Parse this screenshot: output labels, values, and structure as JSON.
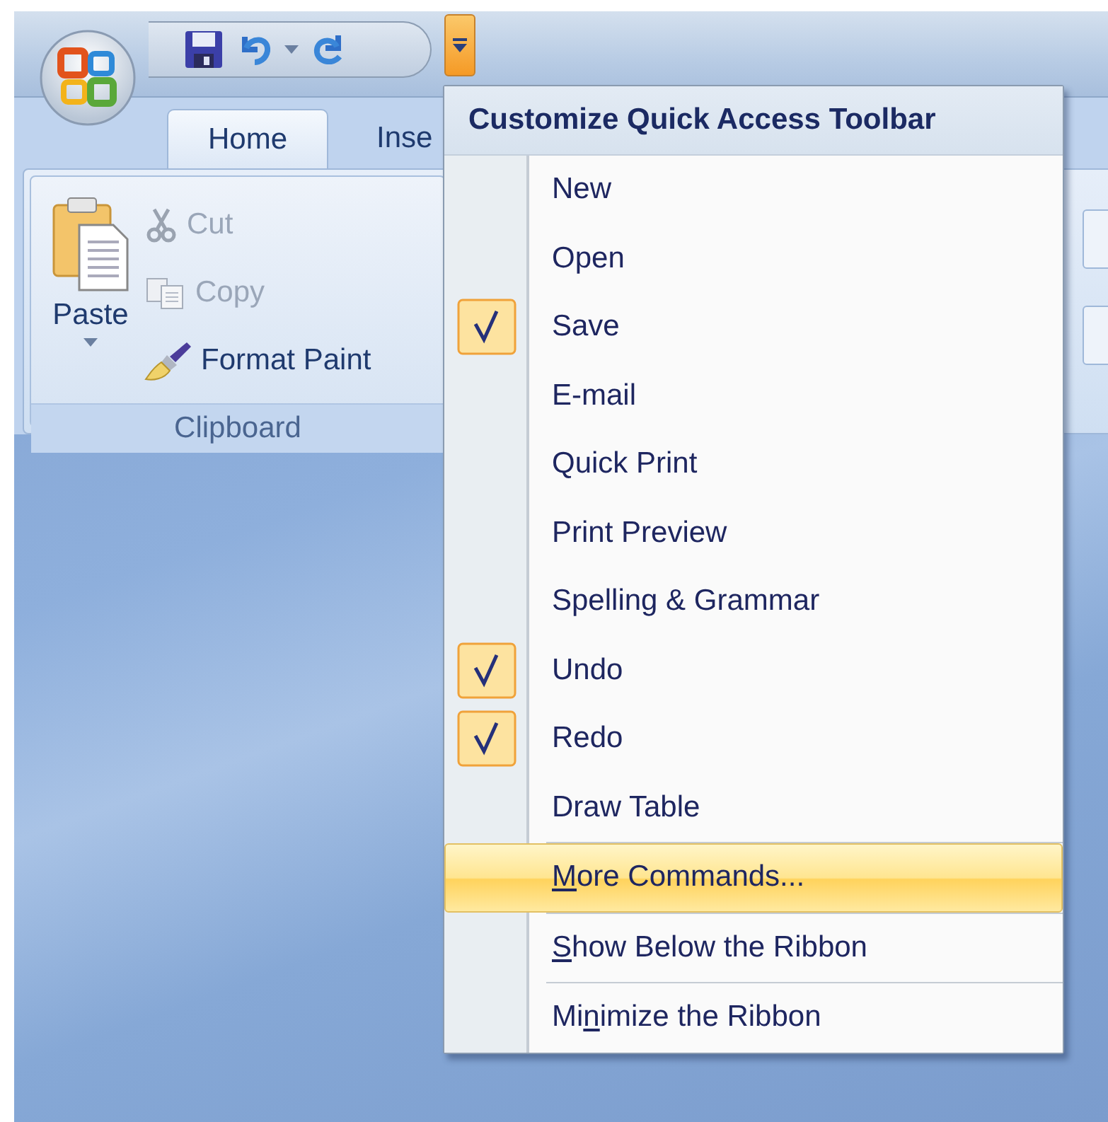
{
  "quick_access_toolbar": {
    "customize_button": {
      "open": true
    }
  },
  "ribbon": {
    "tabs": [
      {
        "label": "Home",
        "selected": true
      },
      {
        "label": "Inse",
        "selected": false
      }
    ],
    "groups": [
      {
        "label": "Clipboard",
        "large_button": {
          "label": "Paste"
        },
        "buttons": [
          {
            "kind": "cut",
            "label": "Cut",
            "disabled": true
          },
          {
            "kind": "copy",
            "label": "Copy",
            "disabled": true
          },
          {
            "kind": "brush",
            "label": "Format Paint",
            "disabled": false
          }
        ]
      }
    ]
  },
  "menu": {
    "title": "Customize Quick Access Toolbar",
    "sections": [
      {
        "items": [
          {
            "kind": "toggle",
            "label": "New",
            "checked": false,
            "highlighted": false
          },
          {
            "kind": "toggle",
            "label": "Open",
            "checked": false,
            "highlighted": false
          },
          {
            "kind": "toggle",
            "label": "Save",
            "checked": true,
            "highlighted": false
          },
          {
            "kind": "toggle",
            "label": "E-mail",
            "checked": false,
            "highlighted": false
          },
          {
            "kind": "toggle",
            "label": "Quick Print",
            "checked": false,
            "highlighted": false
          },
          {
            "kind": "toggle",
            "label": "Print Preview",
            "checked": false,
            "highlighted": false
          },
          {
            "kind": "toggle",
            "label": "Spelling & Grammar",
            "checked": false,
            "highlighted": false
          },
          {
            "kind": "toggle",
            "label": "Undo",
            "checked": true,
            "highlighted": false
          },
          {
            "kind": "toggle",
            "label": "Redo",
            "checked": true,
            "highlighted": false
          },
          {
            "kind": "toggle",
            "label": "Draw Table",
            "checked": false,
            "highlighted": false
          }
        ]
      },
      {
        "items": [
          {
            "kind": "command",
            "access_key": "M",
            "label_after": "ore Commands...",
            "highlighted": true
          }
        ]
      },
      {
        "items": [
          {
            "kind": "command",
            "access_key": "S",
            "label_after": "how Below the Ribbon",
            "highlighted": false
          }
        ]
      },
      {
        "items": [
          {
            "kind": "command",
            "label_before": "Mi",
            "access_key": "n",
            "label_after": "imize the Ribbon",
            "highlighted": false
          }
        ]
      }
    ]
  }
}
